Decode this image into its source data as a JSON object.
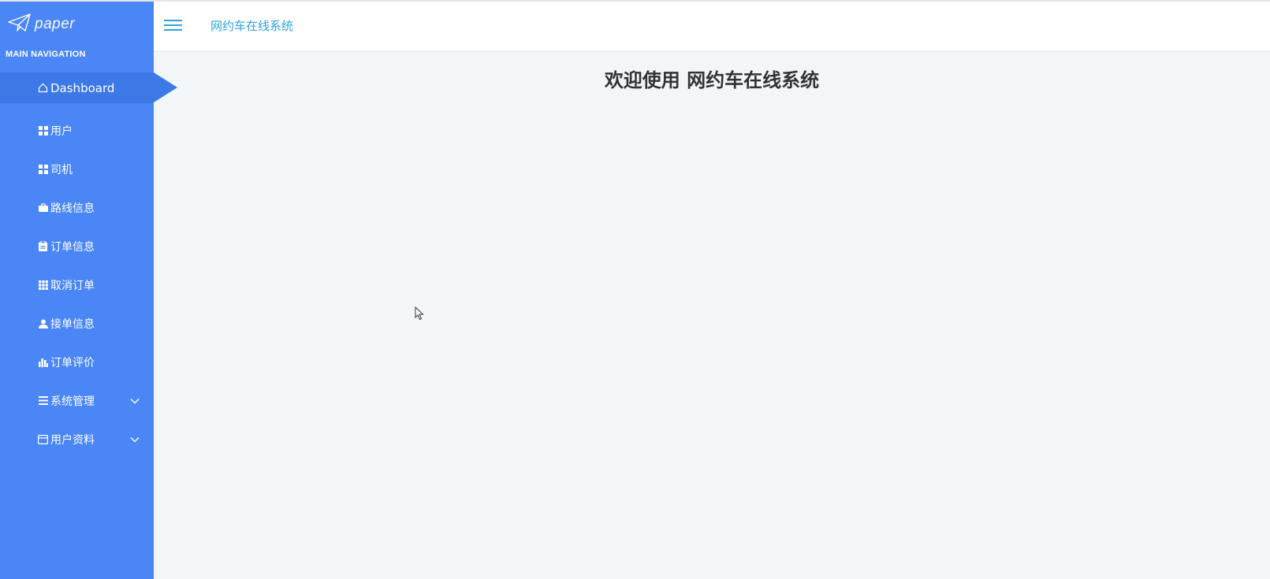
{
  "app": {
    "logo_text": "paper",
    "header_title": "网约车在线系统",
    "welcome_title": "欢迎使用 网约车在线系统"
  },
  "sidebar": {
    "section_title": "MAIN NAVIGATION",
    "items": [
      {
        "label": "Dashboard",
        "icon": "home-icon",
        "active": true
      },
      {
        "label": "用户",
        "icon": "grid-icon"
      },
      {
        "label": "司机",
        "icon": "grid-icon"
      },
      {
        "label": "路线信息",
        "icon": "briefcase-icon"
      },
      {
        "label": "订单信息",
        "icon": "clipboard-icon"
      },
      {
        "label": "取消订单",
        "icon": "table-icon"
      },
      {
        "label": "接单信息",
        "icon": "user-icon"
      },
      {
        "label": "订单评价",
        "icon": "bar-chart-icon"
      },
      {
        "label": "系统管理",
        "icon": "list-icon",
        "expandable": true
      },
      {
        "label": "用户资料",
        "icon": "window-icon",
        "expandable": true
      }
    ]
  },
  "colors": {
    "sidebar_bg": "#4a86f5",
    "active_item_bg": "#3c78e6",
    "header_title": "#2fa3d9",
    "content_bg": "#f3f6f9"
  }
}
